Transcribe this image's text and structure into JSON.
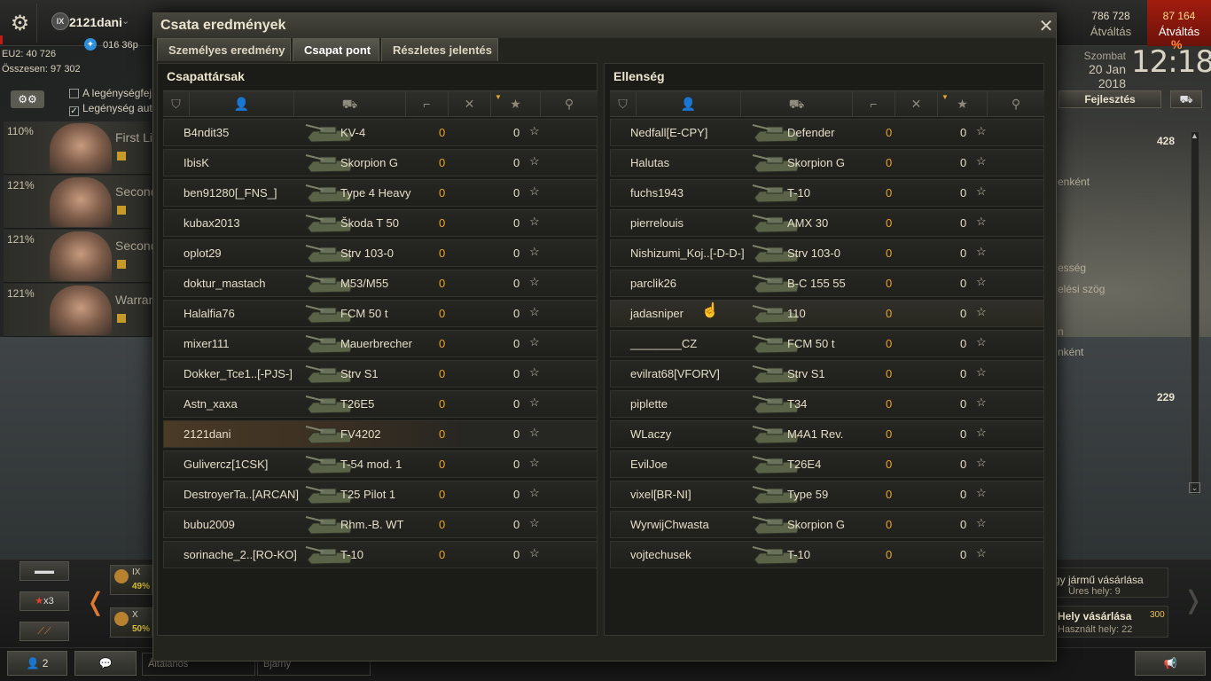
{
  "topbar": {
    "player_tier": "IX",
    "player_name": "2121dani",
    "premium_time": "016 36p",
    "stat_eu2": "EU2: 40 726",
    "stat_total": "Összesen: 97 302",
    "credits": {
      "amount": "786 728",
      "label": "Átváltás"
    },
    "gold": {
      "amount": "87 164",
      "label": "Átváltás"
    },
    "discount": "%",
    "date_day": "Szombat",
    "date_date": "20 Jan 2018",
    "clock": "12:18"
  },
  "crew": {
    "options": [
      "A legénységfej",
      "Legénység aut"
    ],
    "members": [
      {
        "pct": "110%",
        "role": "First Lie"
      },
      {
        "pct": "121%",
        "role": "Second"
      },
      {
        "pct": "121%",
        "role": "Second"
      },
      {
        "pct": "121%",
        "role": "Warran"
      }
    ]
  },
  "right_panel": {
    "upgrade_label": "Fejlesztés",
    "num_1": "428",
    "frag_1": "enként",
    "frag_2": "esség",
    "frag_3": "elési szög",
    "frag_4": "n",
    "frag_5": "nként",
    "num_2": "229"
  },
  "carousel": {
    "filter_elite": "x3",
    "tanks": [
      {
        "tier": "IX",
        "pct": "49%"
      },
      {
        "tier": "X",
        "pct": "50%"
      }
    ],
    "buy_vehicle": {
      "title": "gy jármű vásárlása",
      "sub": "Üres hely: 9"
    },
    "buy_slot": {
      "title": "Hely vásárlása",
      "price": "300",
      "sub": "Használt hely: 22"
    }
  },
  "bottom": {
    "friends_count": "2",
    "channel_general": "Általános",
    "channel_bjarny": "Bjarny"
  },
  "modal": {
    "title": "Csata eredmények",
    "tabs": [
      "Személyes eredmény",
      "Csapat pont",
      "Részletes jelentés"
    ],
    "allies": {
      "title": "Csapattársak",
      "rows": [
        {
          "player": "B4ndit35",
          "tank": "KV-4",
          "frags": "0",
          "xp": "0"
        },
        {
          "player": "IbisK",
          "tank": "Skorpion G",
          "frags": "0",
          "xp": "0"
        },
        {
          "player": "ben91280[_FNS_]",
          "tank": "Type 4 Heavy",
          "frags": "0",
          "xp": "0"
        },
        {
          "player": "kubax2013",
          "tank": "Škoda T 50",
          "frags": "0",
          "xp": "0"
        },
        {
          "player": "oplot29",
          "tank": "Strv 103-0",
          "frags": "0",
          "xp": "0"
        },
        {
          "player": "doktur_mastach",
          "tank": "M53/M55",
          "frags": "0",
          "xp": "0"
        },
        {
          "player": "Halalfia76",
          "tank": "FCM 50 t",
          "frags": "0",
          "xp": "0"
        },
        {
          "player": "mixer111",
          "tank": "Mauerbrecher",
          "frags": "0",
          "xp": "0"
        },
        {
          "player": "Dokker_Tce1..[-PJS-]",
          "tank": "Strv S1",
          "frags": "0",
          "xp": "0"
        },
        {
          "player": "Astn_xaxa",
          "tank": "T26E5",
          "frags": "0",
          "xp": "0"
        },
        {
          "player": "2121dani",
          "tank": "FV4202",
          "frags": "0",
          "xp": "0"
        },
        {
          "player": "Gulivercz[1CSK]",
          "tank": "T-54 mod. 1",
          "frags": "0",
          "xp": "0"
        },
        {
          "player": "DestroyerTa..[ARCAN]",
          "tank": "T25 Pilot 1",
          "frags": "0",
          "xp": "0"
        },
        {
          "player": "bubu2009",
          "tank": "Rhm.-B. WT",
          "frags": "0",
          "xp": "0"
        },
        {
          "player": "sorinache_2..[RO-KO]",
          "tank": "T-10",
          "frags": "0",
          "xp": "0"
        }
      ]
    },
    "enemies": {
      "title": "Ellenség",
      "rows": [
        {
          "player": "Nedfall[E-CPY]",
          "tank": "Defender",
          "frags": "0",
          "xp": "0"
        },
        {
          "player": "Halutas",
          "tank": "Skorpion G",
          "frags": "0",
          "xp": "0"
        },
        {
          "player": "fuchs1943",
          "tank": "T-10",
          "frags": "0",
          "xp": "0"
        },
        {
          "player": "pierrelouis",
          "tank": "AMX 30",
          "frags": "0",
          "xp": "0"
        },
        {
          "player": "Nishizumi_Koj..[-D-D-]",
          "tank": "Strv 103-0",
          "frags": "0",
          "xp": "0"
        },
        {
          "player": "parclik26",
          "tank": "B-C 155 55",
          "frags": "0",
          "xp": "0"
        },
        {
          "player": "jadasniper",
          "tank": "110",
          "frags": "0",
          "xp": "0"
        },
        {
          "player": "________CZ",
          "tank": "FCM 50 t",
          "frags": "0",
          "xp": "0"
        },
        {
          "player": "evilrat68[VFORV]",
          "tank": "Strv S1",
          "frags": "0",
          "xp": "0"
        },
        {
          "player": "piplette",
          "tank": "T34",
          "frags": "0",
          "xp": "0"
        },
        {
          "player": "WLaczy",
          "tank": "M4A1 Rev.",
          "frags": "0",
          "xp": "0"
        },
        {
          "player": "EvilJoe",
          "tank": "T26E4",
          "frags": "0",
          "xp": "0"
        },
        {
          "player": "vixel[BR-NI]",
          "tank": "Type 59",
          "frags": "0",
          "xp": "0"
        },
        {
          "player": "WyrwijChwasta",
          "tank": "Skorpion G",
          "frags": "0",
          "xp": "0"
        },
        {
          "player": "vojtechusek",
          "tank": "T-10",
          "frags": "0",
          "xp": "0"
        }
      ]
    },
    "self_player": "2121dani",
    "hover_player": "jadasniper"
  },
  "colors": {
    "frags": "#e8a62e",
    "self_row": "#4a3a26",
    "gold_bg": "#a21c0f"
  }
}
